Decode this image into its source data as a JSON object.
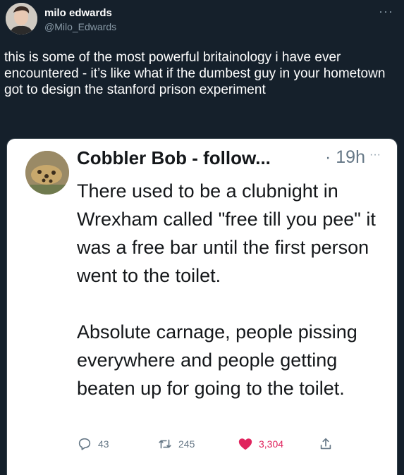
{
  "tweet": {
    "author_name": "milo edwards",
    "author_handle": "@Milo_Edwards",
    "text": "this is some of the most powerful britainology i have ever encountered - it’s like what if the dumbest guy in your hometown got to design the stanford prison experiment",
    "more_icon": "more-icon"
  },
  "quoted": {
    "author_name": "Cobbler Bob - follow...",
    "time": "· 19h",
    "paragraphs": [
      "There used to be a clubnight in Wrexham called \"free till you pee\" it was a free bar until the first person went to the toilet.",
      "Absolute carnage, people pissing everywhere and people getting beaten up for going to the toilet."
    ],
    "actions": {
      "replies": "43",
      "retweets": "245",
      "likes": "3,304"
    },
    "colors": {
      "like": "#e0245e",
      "muted": "#657786"
    }
  }
}
